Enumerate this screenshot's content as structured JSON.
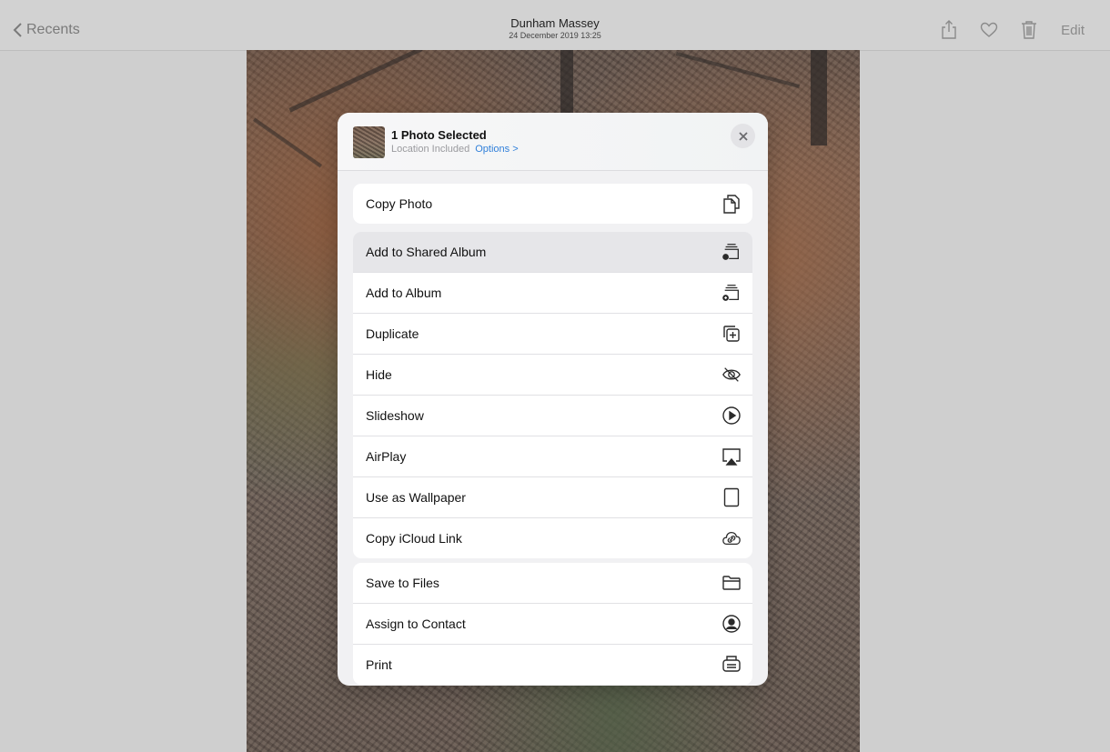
{
  "nav": {
    "back_label": "Recents",
    "title": "Dunham Massey",
    "subtitle": "24 December 2019  13:25",
    "edit_label": "Edit"
  },
  "sheet": {
    "header_title": "1 Photo Selected",
    "header_sub": "Location Included",
    "options_label": "Options >",
    "groups": [
      {
        "items": [
          {
            "label": "Copy Photo",
            "icon": "copy-icon"
          }
        ]
      },
      {
        "items": [
          {
            "label": "Add to Shared Album",
            "icon": "shared-album-icon",
            "highlighted": true
          },
          {
            "label": "Add to Album",
            "icon": "add-album-icon"
          },
          {
            "label": "Duplicate",
            "icon": "duplicate-icon"
          },
          {
            "label": "Hide",
            "icon": "eye-slash-icon"
          },
          {
            "label": "Slideshow",
            "icon": "play-circle-icon"
          },
          {
            "label": "AirPlay",
            "icon": "airplay-icon"
          },
          {
            "label": "Use as Wallpaper",
            "icon": "wallpaper-icon"
          },
          {
            "label": "Copy iCloud Link",
            "icon": "icloud-link-icon"
          }
        ]
      },
      {
        "items": [
          {
            "label": "Save to Files",
            "icon": "folder-icon"
          },
          {
            "label": "Assign to Contact",
            "icon": "contact-icon"
          },
          {
            "label": "Print",
            "icon": "printer-icon"
          }
        ]
      }
    ]
  }
}
